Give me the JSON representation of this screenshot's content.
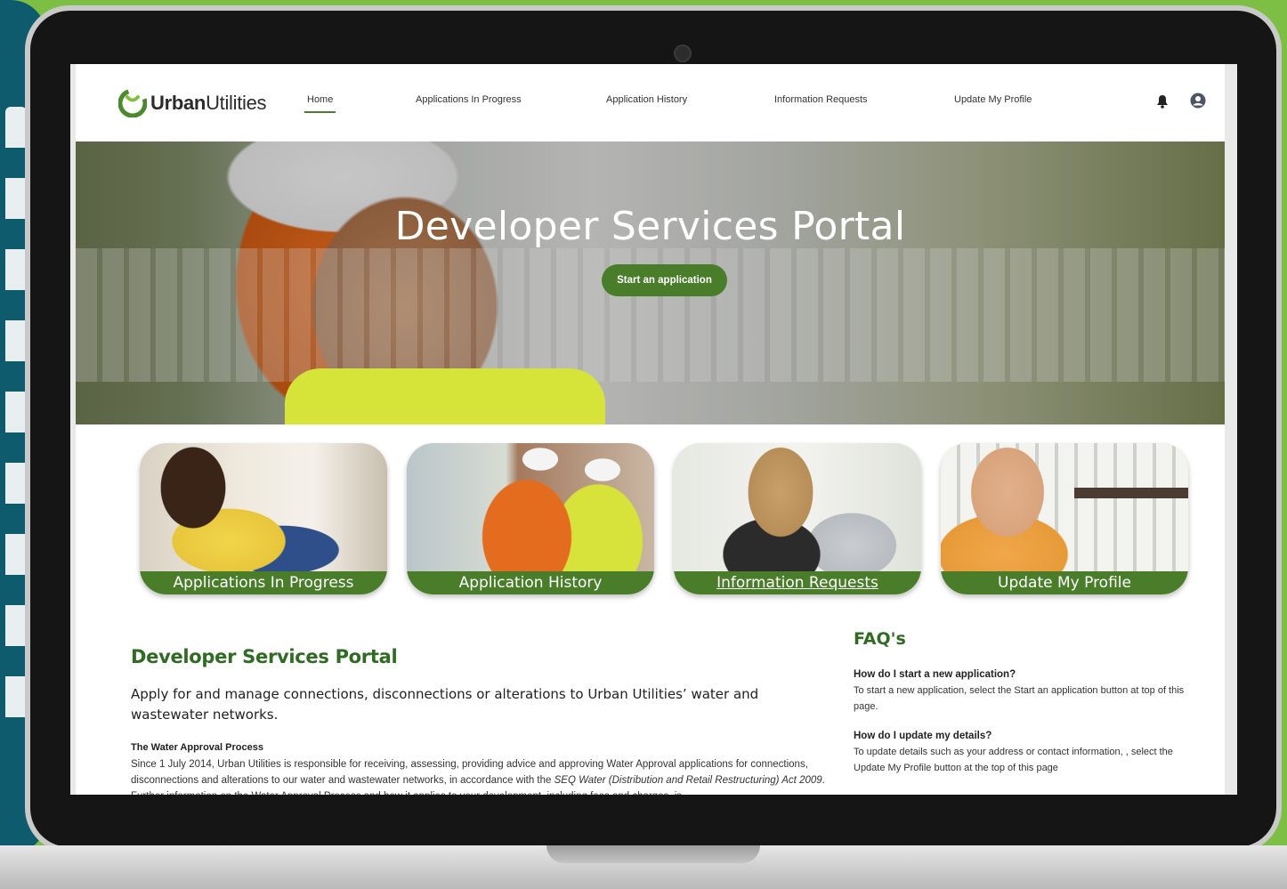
{
  "brand": {
    "name_bold": "Urban",
    "name_light": "Utilities",
    "accent": "#4a7d2a",
    "heading_green": "#2f6b22"
  },
  "nav": {
    "items": [
      {
        "label": "Home"
      },
      {
        "label": "Applications In Progress"
      },
      {
        "label": "Application History"
      },
      {
        "label": "Information Requests"
      },
      {
        "label": "Update My Profile"
      }
    ],
    "icons": [
      "bell-icon",
      "user-avatar-icon"
    ]
  },
  "hero": {
    "title": "Developer Services Portal",
    "cta": "Start an application"
  },
  "tiles": [
    {
      "label": "Applications In Progress"
    },
    {
      "label": "Application History"
    },
    {
      "label": "Information Requests"
    },
    {
      "label": "Update My Profile"
    }
  ],
  "intro": {
    "title": "Developer Services Portal",
    "lede": "Apply for and manage connections, disconnections or alterations to Urban Utilities’ water and wastewater networks.",
    "section_title": "The Water Approval Process",
    "p1": "Since 1 July 2014, Urban Utilities is responsible for receiving, assessing, providing advice and approving Water Approval applications for connections, disconnections and alterations to our water and wastewater networks, in accordance with the",
    "p1_italic": "SEQ Water (Distribution and Retail Restructuring) Act 2009",
    "p1_tail": ". Further information on the Water Approval Process and how it applies to your development, including fees and charges, is"
  },
  "faq": {
    "title": "FAQ's",
    "items": [
      {
        "q": "How do I start a new application?",
        "a": "To start a new application, select the Start an application button at top of this page."
      },
      {
        "q": "How do I update my details?",
        "a": "To update details such as your address or contact information, , select the Update My Profile button at the top of this page"
      }
    ]
  }
}
